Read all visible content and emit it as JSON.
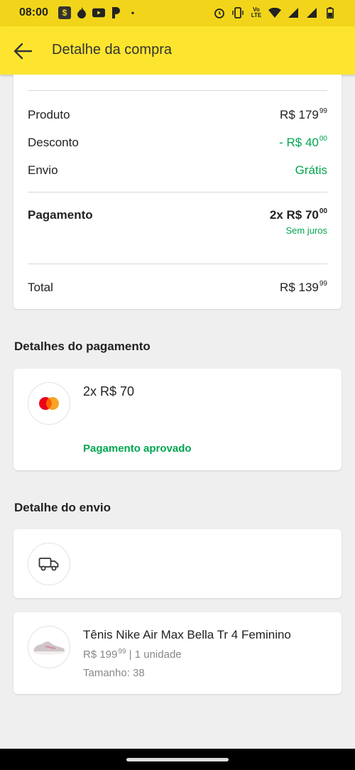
{
  "status_bar": {
    "time": "08:00",
    "app_icons": [
      "dollar-app-icon",
      "flame-icon",
      "youtube-icon",
      "p-app-icon",
      "dot-icon"
    ],
    "right_icons": [
      "alarm-icon",
      "vibrate-icon",
      "volte-icon",
      "wifi-icon",
      "signal-icon",
      "signal-icon",
      "battery-icon"
    ],
    "lte_label": "Vo LTE"
  },
  "header": {
    "title": "Detalhe da compra"
  },
  "summary": {
    "product_label": "Produto",
    "product_value": "R$ 179",
    "product_cents": "99",
    "discount_label": "Desconto",
    "discount_value": "- R$ 40",
    "discount_cents": "00",
    "shipping_label": "Envio",
    "shipping_value": "Grátis",
    "payment_label": "Pagamento",
    "payment_value": "2x R$ 70",
    "payment_cents": "00",
    "payment_note": "Sem juros",
    "total_label": "Total",
    "total_value": "R$ 139",
    "total_cents": "99"
  },
  "payment_details": {
    "section_title": "Detalhes do pagamento",
    "amount": "2x R$ 70",
    "status": "Pagamento aprovado"
  },
  "shipping_details": {
    "section_title": "Detalhe do envio"
  },
  "product": {
    "name": "Tênis Nike Air Max Bella Tr 4 Feminino",
    "price": "R$ 199",
    "price_cents": "99",
    "quantity": "| 1 unidade",
    "size": "Tamanho: 38"
  },
  "colors": {
    "header_yellow": "#fde52f",
    "status_yellow": "#f2d51a",
    "green": "#00a650"
  }
}
